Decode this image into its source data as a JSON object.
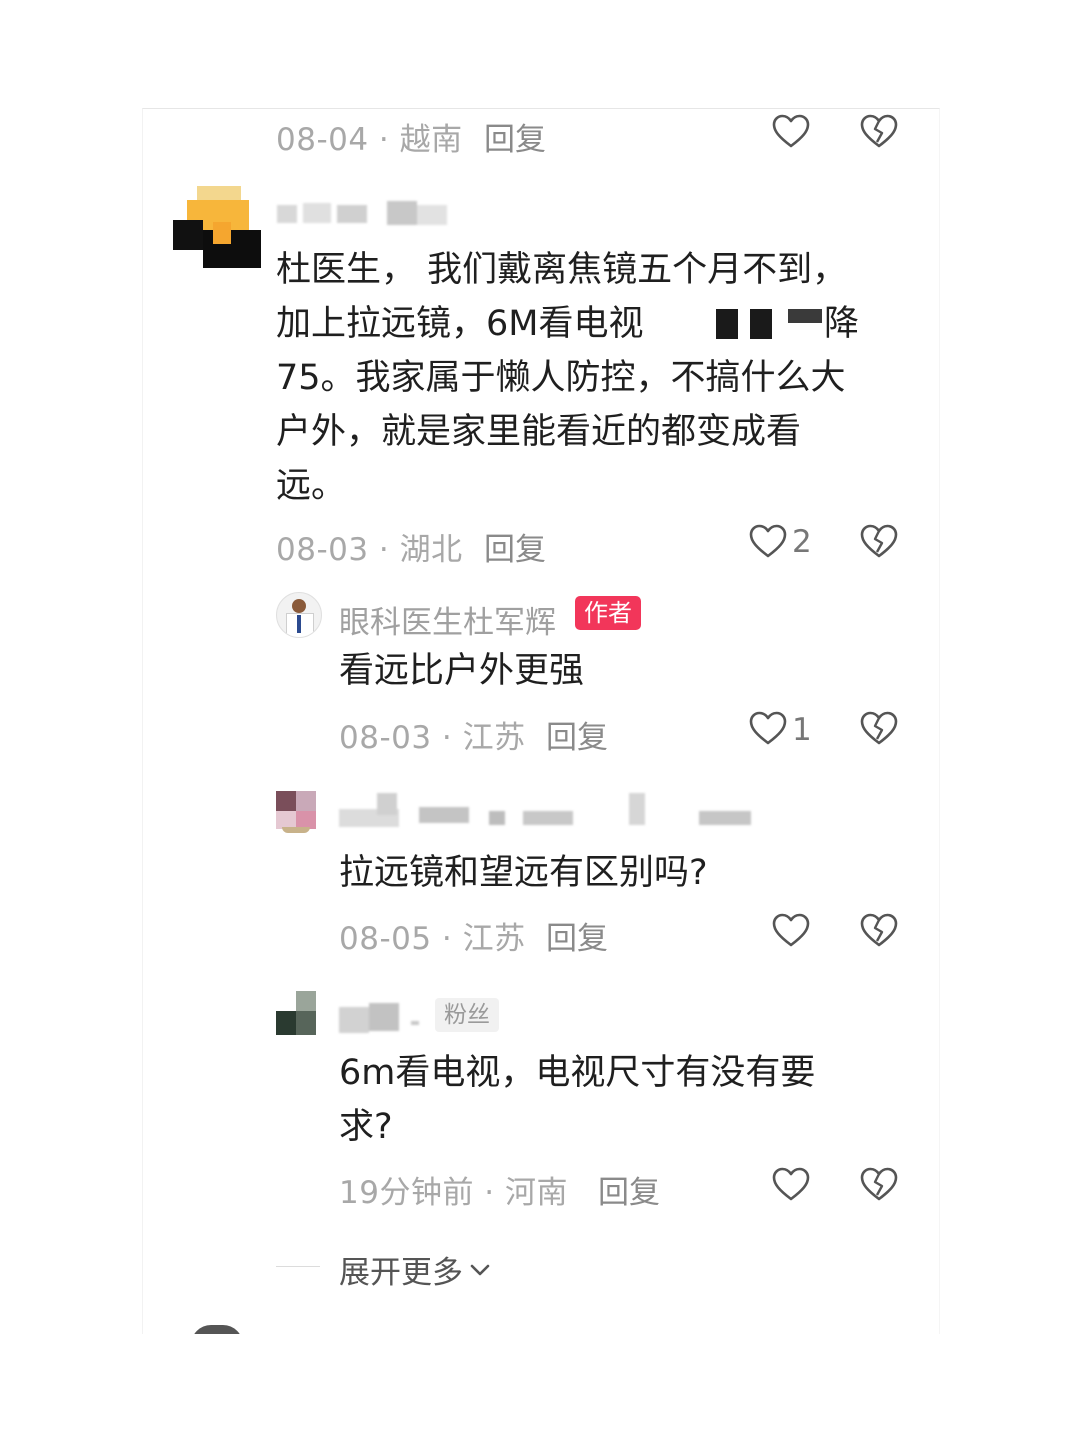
{
  "comments": [
    {
      "id": "c0",
      "date_location": "08-04 · 越南",
      "reply_label": "回复",
      "like_count": ""
    },
    {
      "id": "c1",
      "author": "",
      "body_lines": [
        "杜医生， 我们戴离焦镜五个月不到，",
        "加上拉远镜，6M看电视",
        "75。我家属于懒人防控，不搞什么大",
        "户外，就是家里能看近的都变成看",
        "远。"
      ],
      "body_partial_end": "降",
      "date_location": "08-03 · 湖北",
      "reply_label": "回复",
      "like_count": "2"
    }
  ],
  "replies": [
    {
      "id": "r1",
      "author": "眼科医生杜军辉",
      "badge": "作者",
      "body_lines": [
        "看远比户外更强"
      ],
      "date_location": "08-03 · 江苏",
      "reply_label": "回复",
      "like_count": "1"
    },
    {
      "id": "r2",
      "author": "",
      "body_lines": [
        "拉远镜和望远有区别吗?"
      ],
      "date_location": "08-05 · 江苏",
      "reply_label": "回复",
      "like_count": ""
    },
    {
      "id": "r3",
      "author": "",
      "badge": "粉丝",
      "body_lines": [
        "6m看电视，电视尺寸有没有要",
        "求?"
      ],
      "date_location": "19分钟前 · 河南",
      "reply_label": "回复",
      "like_count": ""
    }
  ],
  "expand_more": "展开更多",
  "icons": {
    "like": "heart-outline-icon",
    "dislike": "broken-heart-icon",
    "expand": "chevron-down-icon"
  },
  "colors": {
    "author_badge": "#f2365a",
    "meta_text": "#a8a8a8",
    "body_text": "#1f1f1f"
  }
}
